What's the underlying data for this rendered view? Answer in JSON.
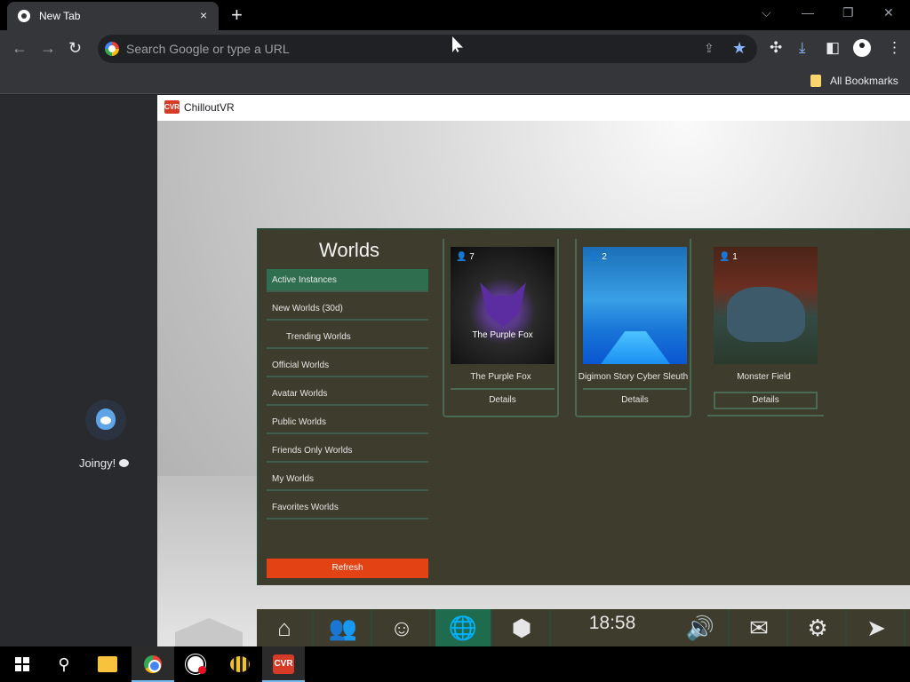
{
  "browser": {
    "tab_title": "New Tab",
    "tab_close": "×",
    "new_tab": "+",
    "window_controls": {
      "dropdown": "⌵",
      "minimize": "—",
      "restore": "❐",
      "close": "✕"
    },
    "nav": {
      "back": "←",
      "forward": "→",
      "reload": "↻"
    },
    "omnibox_placeholder": "Search Google or type a URL",
    "bookmarks_label": "All Bookmarks",
    "accent_color": "#8ab4f8"
  },
  "sidebar": {
    "contact_name": "Joingy!"
  },
  "cvr_window": {
    "title": "ChilloutVR",
    "icon_text": "CVR"
  },
  "worlds": {
    "heading": "Worlds",
    "categories": [
      {
        "label": "Active Instances"
      },
      {
        "label": "New Worlds (30d)"
      },
      {
        "label": "Trending Worlds"
      },
      {
        "label": "Official Worlds"
      },
      {
        "label": "Avatar Worlds"
      },
      {
        "label": "Public Worlds"
      },
      {
        "label": "Friends Only Worlds"
      },
      {
        "label": "My Worlds"
      },
      {
        "label": "Favorites Worlds"
      }
    ],
    "refresh_label": "Refresh",
    "cards": [
      {
        "name": "The Purple Fox",
        "count": "7",
        "thumb_label": "The Purple Fox",
        "details_label": "Details"
      },
      {
        "name": "Digimon Story Cyber Sleuth",
        "count": "2",
        "details_label": "Details"
      },
      {
        "name": "Monster Field",
        "count": "1",
        "details_label": "Details"
      }
    ]
  },
  "dock": {
    "clock": "18:58",
    "buttons": [
      "home",
      "friends",
      "profile",
      "worlds",
      "avatars",
      "clock",
      "volume",
      "messages",
      "settings",
      "pointer"
    ]
  },
  "taskbar": {
    "apps": [
      "start",
      "search",
      "file-explorer",
      "chrome",
      "obs",
      "bee",
      "chilloutvr"
    ],
    "search_glyph": "⚲"
  }
}
